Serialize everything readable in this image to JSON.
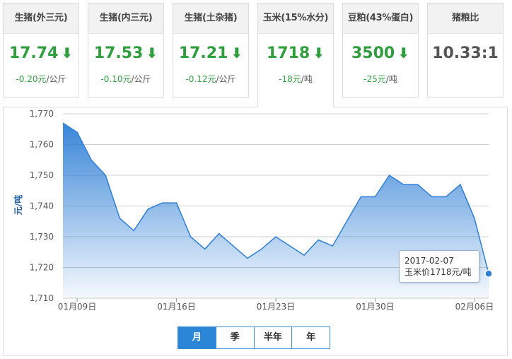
{
  "cards": [
    {
      "title": "生猪(外三元)",
      "price": "17.74",
      "change": "-0.20元",
      "unit": "/公斤",
      "arrow": "down"
    },
    {
      "title": "生猪(内三元)",
      "price": "17.53",
      "change": "-0.10元",
      "unit": "/公斤",
      "arrow": "down"
    },
    {
      "title": "生猪(土杂猪)",
      "price": "17.21",
      "change": "-0.12元",
      "unit": "/公斤",
      "arrow": "down"
    },
    {
      "title": "玉米(15%水分)",
      "price": "1718",
      "change": "-18元",
      "unit": "/吨",
      "arrow": "down"
    },
    {
      "title": "豆粕(43%蛋白)",
      "price": "3500",
      "change": "-25元",
      "unit": "/吨",
      "arrow": "down"
    },
    {
      "title": "猪粮比",
      "ratio": "10.33:1"
    }
  ],
  "active_card": 3,
  "colors": {
    "down": "#2f9e3c",
    "area_top": "#2e7fd6",
    "line": "#2e7fd6",
    "accent": "#2b86d8"
  },
  "range_buttons": [
    "月",
    "季",
    "半年",
    "年"
  ],
  "range_selected": "月",
  "tooltip": {
    "date": "2017-02-07",
    "text": "玉米价1718元/吨"
  },
  "chart_data": {
    "type": "area",
    "ylabel": "元/吨",
    "ylim": [
      1710,
      1770
    ],
    "yticks": [
      "1,770",
      "1,760",
      "1,750",
      "1,740",
      "1,730",
      "1,720",
      "1,710"
    ],
    "xticks": [
      "01月09日",
      "01月16日",
      "01月23日",
      "01月30日",
      "02月06日"
    ],
    "x": [
      "01-08",
      "01-09",
      "01-10",
      "01-11",
      "01-12",
      "01-13",
      "01-14",
      "01-15",
      "01-16",
      "01-17",
      "01-18",
      "01-19",
      "01-20",
      "01-21",
      "01-22",
      "01-23",
      "01-24",
      "01-25",
      "01-26",
      "01-27",
      "01-28",
      "01-29",
      "01-30",
      "01-31",
      "02-01",
      "02-02",
      "02-03",
      "02-04",
      "02-05",
      "02-06",
      "02-07"
    ],
    "values": [
      1767,
      1764,
      1755,
      1750,
      1736,
      1732,
      1739,
      1741,
      1741,
      1730,
      1726,
      1731,
      1727,
      1723,
      1726,
      1730,
      1727,
      1724,
      1729,
      1727,
      1735,
      1743,
      1743,
      1750,
      1747,
      1747,
      1743,
      1743,
      1747,
      1736,
      1718
    ],
    "grid": true
  }
}
